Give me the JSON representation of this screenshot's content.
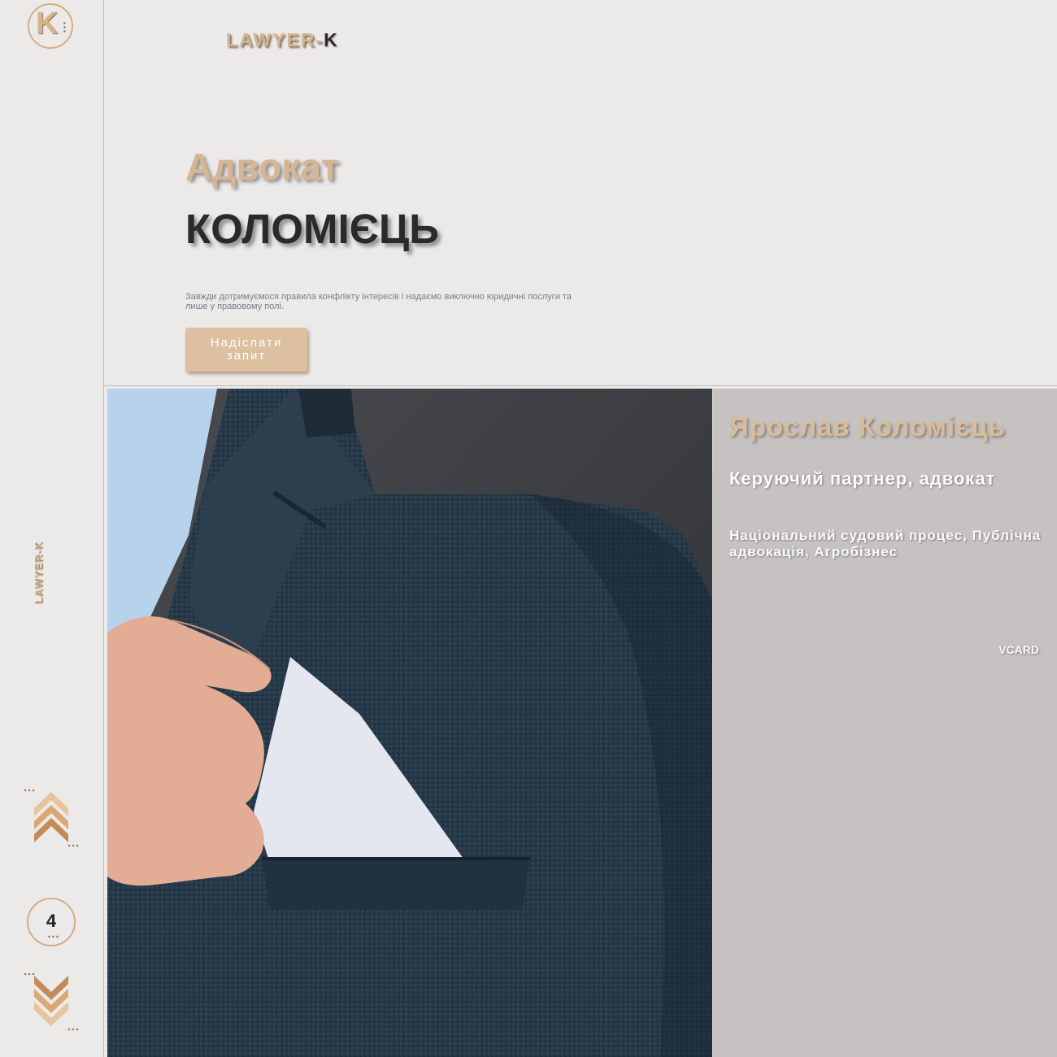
{
  "sidebar": {
    "logo_letter": "K",
    "brand_vertical": "LAWYER-K",
    "page_number": "4",
    "nav_up_icon": "double-chevron-up-icon",
    "nav_down_icon": "double-chevron-down-icon"
  },
  "header": {
    "brand_main": "LAWYER-",
    "brand_accent": "K"
  },
  "hero": {
    "title_line1": "Адвокат",
    "title_line2": "КОЛОМІЄЦЬ",
    "description": "Завжди дотримуємося правила конфлікту інтересів і надаємо виключно юридичні послуги та лише у правовому полі.",
    "button_label": "Надіслати запит"
  },
  "profile": {
    "name": "Ярослав Коломієць",
    "role": "Керуючий партнер, адвокат",
    "practice_areas": "Національний судовий процес, Публічна адвокація, Агробізнес",
    "vcard_label": "VCARD"
  },
  "colors": {
    "accent": "#d4b693",
    "background": "#ece9e9",
    "panel": "#c7c2c2",
    "dark_text": "#2a2a2a"
  }
}
